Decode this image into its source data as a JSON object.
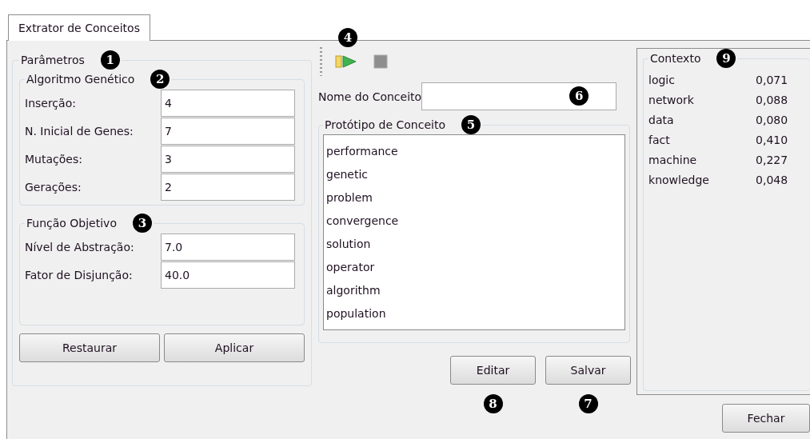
{
  "tab": {
    "label": "Extrator de Conceitos",
    "selected": true
  },
  "parametros": {
    "title": "Parâmetros",
    "callout": "1",
    "algoritmo_genetico": {
      "title": "Algoritmo Genético",
      "callout": "2",
      "fields": [
        {
          "label": "Inserção:",
          "value": "4"
        },
        {
          "label": "N. Inicial de Genes:",
          "value": "7"
        },
        {
          "label": "Mutações:",
          "value": "3"
        },
        {
          "label": "Gerações:",
          "value": "2"
        }
      ]
    },
    "funcao_objetivo": {
      "title": "Função Objetivo",
      "callout": "3",
      "fields": [
        {
          "label": "Nível de Abstração:",
          "value": "7.0"
        },
        {
          "label": "Fator de Disjunção:",
          "value": "40.0"
        }
      ]
    },
    "buttons": [
      "Restaurar",
      "Aplicar"
    ]
  },
  "toolbar": {
    "callout": "4",
    "tools": [
      {
        "kind": "run",
        "disabled": false
      },
      {
        "kind": "stop",
        "disabled": true
      }
    ]
  },
  "nome_do_conceito": {
    "label": "Nome do Conceito",
    "callout": "6"
  },
  "prototipo": {
    "title": "Protótipo de Conceito",
    "callout": "5",
    "items": [
      "performance",
      "genetic",
      "problem",
      "convergence",
      "solution",
      "operator",
      "algorithm",
      "population"
    ]
  },
  "concept_buttons": [
    {
      "label": "Editar",
      "callout": "8"
    },
    {
      "label": "Salvar",
      "callout": "7"
    }
  ],
  "contexto": {
    "title": "Contexto",
    "callout": "9",
    "rows": [
      {
        "term": "logic",
        "weight": "0,071"
      },
      {
        "term": "network",
        "weight": "0,088"
      },
      {
        "term": "data",
        "weight": "0,080"
      },
      {
        "term": "fact",
        "weight": "0,410"
      },
      {
        "term": "machine",
        "weight": "0,227"
      },
      {
        "term": "knowledge",
        "weight": "0,048"
      }
    ]
  },
  "close_button": "Fechar"
}
